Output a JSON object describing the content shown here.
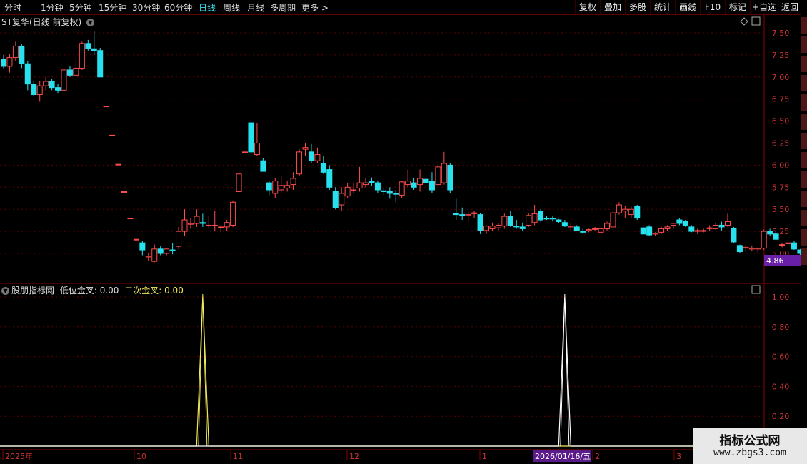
{
  "toolbar": {
    "tabs": [
      "分时",
      "1分钟",
      "5分钟",
      "15分钟",
      "30分钟",
      "60分钟",
      "日线",
      "周线",
      "月线",
      "多周期",
      "更多 >"
    ],
    "active": "日线",
    "buttons": [
      "复权",
      "叠加",
      "多股",
      "统计",
      "画线",
      "F10",
      "标记",
      "+自选",
      "返回"
    ]
  },
  "main": {
    "stock_title": "ST复华(日线 前复权)",
    "price_label": "4.86",
    "colors": {
      "up": "#ff4d4d",
      "down": "#27e2ee",
      "label_bg": "#6a1fa8"
    }
  },
  "indicator": {
    "title": "股朋指标网",
    "param1": "低位金叉: 0.00",
    "param2": "二次金叉: 0.00",
    "colors": {
      "series1": "#f2e85c",
      "series2": "#ffffff"
    }
  },
  "x_axis": {
    "labels": [
      "2025年",
      "10",
      "11",
      "12",
      "1",
      "2",
      "3"
    ],
    "date_highlight": "2026/01/16/五"
  },
  "chart_data": [
    {
      "type": "candlestick",
      "title": "ST复华(日线 前复权)",
      "yticks": [
        5.0,
        5.25,
        5.5,
        5.75,
        6.0,
        6.25,
        6.5,
        6.75,
        7.0,
        7.25,
        7.5
      ],
      "ylim": [
        4.88,
        7.6
      ],
      "last_price": 4.86,
      "candles": [
        [
          7.2,
          7.25,
          7.1,
          7.12
        ],
        [
          7.12,
          7.26,
          7.05,
          7.22
        ],
        [
          7.22,
          7.4,
          7.18,
          7.35
        ],
        [
          7.35,
          7.37,
          7.1,
          7.15
        ],
        [
          7.15,
          7.18,
          6.85,
          6.92
        ],
        [
          6.92,
          6.95,
          6.78,
          6.8
        ],
        [
          6.8,
          6.95,
          6.72,
          6.9
        ],
        [
          6.9,
          7.0,
          6.85,
          6.95
        ],
        [
          6.95,
          6.98,
          6.85,
          6.88
        ],
        [
          6.88,
          6.92,
          6.82,
          6.85
        ],
        [
          6.85,
          7.12,
          6.82,
          7.08
        ],
        [
          7.08,
          7.12,
          7.0,
          7.02
        ],
        [
          7.02,
          7.2,
          7.0,
          7.1
        ],
        [
          7.1,
          7.4,
          7.08,
          7.38
        ],
        [
          7.38,
          7.42,
          7.3,
          7.32
        ],
        [
          7.32,
          7.52,
          7.25,
          7.3
        ],
        [
          7.3,
          7.33,
          7.0,
          7.0
        ],
        [
          6.67,
          6.67,
          6.67,
          6.67
        ],
        [
          6.34,
          6.34,
          6.34,
          6.34
        ],
        [
          6.01,
          6.01,
          6.01,
          6.01
        ],
        [
          5.7,
          5.7,
          5.7,
          5.7
        ],
        [
          5.4,
          5.4,
          5.4,
          5.4
        ],
        [
          5.16,
          5.16,
          5.16,
          5.16
        ],
        [
          5.12,
          5.14,
          4.98,
          5.04
        ],
        [
          4.96,
          5.01,
          4.91,
          4.97
        ],
        [
          4.91,
          5.1,
          4.9,
          5.05
        ],
        [
          5.05,
          5.08,
          4.98,
          5.0
        ],
        [
          5.0,
          5.06,
          4.98,
          5.05
        ],
        [
          5.04,
          5.12,
          4.99,
          5.03
        ],
        [
          5.08,
          5.3,
          5.05,
          5.25
        ],
        [
          5.25,
          5.5,
          5.2,
          5.38
        ],
        [
          5.33,
          5.4,
          5.28,
          5.34
        ],
        [
          5.34,
          5.5,
          5.3,
          5.42
        ],
        [
          5.35,
          5.45,
          5.3,
          5.34
        ],
        [
          5.32,
          5.42,
          5.28,
          5.32
        ],
        [
          5.32,
          5.48,
          5.25,
          5.32
        ],
        [
          5.3,
          5.32,
          5.24,
          5.3
        ],
        [
          5.3,
          5.38,
          5.25,
          5.35
        ],
        [
          5.32,
          5.6,
          5.3,
          5.58
        ],
        [
          5.7,
          5.95,
          5.68,
          5.9
        ],
        [
          6.15,
          6.15,
          6.14,
          6.15
        ],
        [
          6.48,
          6.52,
          6.1,
          6.15
        ],
        [
          6.12,
          6.48,
          6.1,
          6.25
        ],
        [
          6.05,
          6.08,
          5.93,
          5.93
        ],
        [
          5.8,
          5.82,
          5.66,
          5.72
        ],
        [
          5.68,
          5.85,
          5.63,
          5.82
        ],
        [
          5.72,
          5.88,
          5.68,
          5.77
        ],
        [
          5.74,
          5.82,
          5.7,
          5.77
        ],
        [
          5.78,
          5.92,
          5.72,
          5.85
        ],
        [
          5.9,
          6.18,
          5.88,
          6.15
        ],
        [
          6.18,
          6.25,
          6.1,
          6.2
        ],
        [
          6.15,
          6.24,
          6.02,
          6.05
        ],
        [
          6.05,
          6.2,
          6.02,
          6.12
        ],
        [
          6.02,
          6.1,
          5.9,
          5.92
        ],
        [
          5.95,
          6.0,
          5.72,
          5.75
        ],
        [
          5.7,
          5.75,
          5.5,
          5.52
        ],
        [
          5.55,
          5.75,
          5.48,
          5.68
        ],
        [
          5.65,
          5.8,
          5.63,
          5.75
        ],
        [
          5.72,
          5.8,
          5.68,
          5.72
        ],
        [
          5.74,
          5.98,
          5.7,
          5.8
        ],
        [
          5.78,
          5.85,
          5.75,
          5.8
        ],
        [
          5.82,
          5.86,
          5.76,
          5.8
        ],
        [
          5.8,
          5.82,
          5.68,
          5.72
        ],
        [
          5.71,
          5.74,
          5.66,
          5.7
        ],
        [
          5.7,
          5.75,
          5.62,
          5.68
        ],
        [
          5.68,
          5.72,
          5.58,
          5.67
        ],
        [
          5.66,
          5.82,
          5.63,
          5.81
        ],
        [
          5.78,
          5.95,
          5.75,
          5.82
        ],
        [
          5.8,
          5.85,
          5.72,
          5.75
        ],
        [
          5.78,
          5.95,
          5.7,
          5.85
        ],
        [
          5.84,
          6.0,
          5.75,
          5.8
        ],
        [
          5.82,
          5.92,
          5.68,
          5.72
        ],
        [
          5.78,
          6.05,
          5.75,
          5.98
        ],
        [
          5.8,
          6.15,
          5.78,
          6.02
        ],
        [
          6.0,
          6.02,
          5.68,
          5.72
        ],
        [
          5.45,
          5.62,
          5.38,
          5.44
        ],
        [
          5.44,
          5.52,
          5.38,
          5.43
        ],
        [
          5.43,
          5.47,
          5.36,
          5.44
        ],
        [
          5.45,
          5.48,
          5.4,
          5.46
        ],
        [
          5.44,
          5.46,
          5.22,
          5.26
        ],
        [
          5.26,
          5.32,
          5.22,
          5.31
        ],
        [
          5.28,
          5.35,
          5.25,
          5.31
        ],
        [
          5.29,
          5.34,
          5.26,
          5.32
        ],
        [
          5.31,
          5.45,
          5.28,
          5.42
        ],
        [
          5.42,
          5.48,
          5.3,
          5.32
        ],
        [
          5.31,
          5.38,
          5.28,
          5.3
        ],
        [
          5.3,
          5.35,
          5.25,
          5.28
        ],
        [
          5.32,
          5.46,
          5.3,
          5.43
        ],
        [
          5.35,
          5.55,
          5.32,
          5.45
        ],
        [
          5.48,
          5.5,
          5.36,
          5.38
        ],
        [
          5.4,
          5.42,
          5.38,
          5.39
        ],
        [
          5.4,
          5.42,
          5.36,
          5.39
        ],
        [
          5.38,
          5.39,
          5.34,
          5.36
        ],
        [
          5.35,
          5.38,
          5.3,
          5.31
        ],
        [
          5.3,
          5.34,
          5.26,
          5.31
        ],
        [
          5.3,
          5.32,
          5.25,
          5.26
        ],
        [
          5.25,
          5.28,
          5.22,
          5.24
        ],
        [
          5.26,
          5.28,
          5.24,
          5.27
        ],
        [
          5.28,
          5.3,
          5.26,
          5.28
        ],
        [
          5.24,
          5.3,
          5.22,
          5.28
        ],
        [
          5.28,
          5.36,
          5.26,
          5.34
        ],
        [
          5.3,
          5.48,
          5.3,
          5.46
        ],
        [
          5.46,
          5.58,
          5.44,
          5.55
        ],
        [
          5.48,
          5.54,
          5.4,
          5.5
        ],
        [
          5.44,
          5.53,
          5.4,
          5.5
        ],
        [
          5.53,
          5.55,
          5.38,
          5.4
        ],
        [
          5.29,
          5.3,
          5.22,
          5.22
        ],
        [
          5.3,
          5.32,
          5.2,
          5.21
        ],
        [
          5.22,
          5.24,
          5.2,
          5.23
        ],
        [
          5.24,
          5.3,
          5.22,
          5.28
        ],
        [
          5.28,
          5.32,
          5.26,
          5.3
        ],
        [
          5.32,
          5.35,
          5.28,
          5.34
        ],
        [
          5.38,
          5.4,
          5.32,
          5.34
        ],
        [
          5.36,
          5.38,
          5.3,
          5.32
        ],
        [
          5.3,
          5.32,
          5.24,
          5.25
        ],
        [
          5.25,
          5.28,
          5.22,
          5.26
        ],
        [
          5.25,
          5.28,
          5.24,
          5.26
        ],
        [
          5.28,
          5.32,
          5.25,
          5.29
        ],
        [
          5.28,
          5.35,
          5.27,
          5.32
        ],
        [
          5.32,
          5.36,
          5.26,
          5.3
        ],
        [
          5.32,
          5.45,
          5.3,
          5.36
        ],
        [
          5.28,
          5.3,
          5.12,
          5.13
        ],
        [
          5.09,
          5.1,
          5.0,
          5.02
        ],
        [
          5.06,
          5.1,
          5.02,
          5.07
        ],
        [
          5.05,
          5.09,
          5.03,
          5.06
        ],
        [
          5.05,
          5.07,
          5.01,
          5.06
        ],
        [
          5.06,
          5.27,
          5.04,
          5.25
        ],
        [
          5.25,
          5.28,
          5.2,
          5.22
        ],
        [
          5.22,
          5.24,
          5.16,
          5.16
        ],
        [
          5.1,
          5.12,
          5.07,
          5.1
        ],
        [
          5.11,
          5.13,
          5.1,
          5.12
        ],
        [
          5.12,
          5.14,
          5.04,
          5.05
        ],
        [
          5.04,
          5.05,
          4.98,
          5.0
        ]
      ]
    },
    {
      "type": "line",
      "title": "股朋指标网",
      "ylim": [
        0,
        1.05
      ],
      "yticks": [
        0.2,
        0.4,
        0.6,
        0.8,
        1.0
      ],
      "series": [
        {
          "name": "低位金叉",
          "spike_at": 33,
          "value": 1
        },
        {
          "name": "二次金叉",
          "spike_at": 93,
          "value": 1
        }
      ]
    }
  ]
}
